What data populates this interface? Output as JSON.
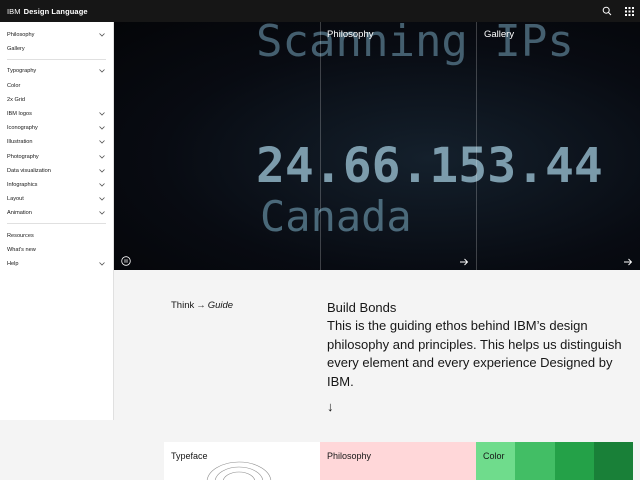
{
  "header": {
    "brand_prefix": "IBM",
    "brand_name": "Design Language",
    "icons": [
      "search-icon",
      "app-switcher-icon"
    ]
  },
  "sidebar": {
    "items": [
      {
        "label": "Philosophy",
        "expandable": true
      },
      {
        "label": "Gallery",
        "expandable": false
      },
      {
        "label": "Typography",
        "expandable": true
      },
      {
        "label": "Color",
        "expandable": false
      },
      {
        "label": "2x Grid",
        "expandable": false
      },
      {
        "label": "IBM logos",
        "expandable": true
      },
      {
        "label": "Iconography",
        "expandable": true
      },
      {
        "label": "Illustration",
        "expandable": true
      },
      {
        "label": "Photography",
        "expandable": true
      },
      {
        "label": "Data visualization",
        "expandable": true
      },
      {
        "label": "Infographics",
        "expandable": true
      },
      {
        "label": "Layout",
        "expandable": true
      },
      {
        "label": "Animation",
        "expandable": true
      },
      {
        "label": "Resources",
        "expandable": false
      },
      {
        "label": "What's new",
        "expandable": false
      },
      {
        "label": "Help",
        "expandable": true
      }
    ]
  },
  "hero": {
    "bg_lines": [
      "Scanning IPs",
      "24.66.153.44",
      "Canada"
    ],
    "panels": [
      {
        "label": "Philosophy"
      },
      {
        "label": "Gallery"
      }
    ]
  },
  "intro": {
    "think": "Think",
    "arrow": "→",
    "guide": "Guide",
    "title": "Build Bonds",
    "body": "This is the guiding ethos behind IBM’s design philosophy and principles. This helps us distinguish every element and every experience Designed by IBM.",
    "down_arrow": "↓"
  },
  "tiles": [
    {
      "label": "Typeface"
    },
    {
      "label": "Philosophy"
    },
    {
      "label": "Color",
      "swatches": [
        "#6fdc8c",
        "#42be65",
        "#24a148",
        "#198038"
      ]
    }
  ],
  "colors": {
    "header_bg": "#161616",
    "philosophy_tile": "#ffd7d9"
  }
}
